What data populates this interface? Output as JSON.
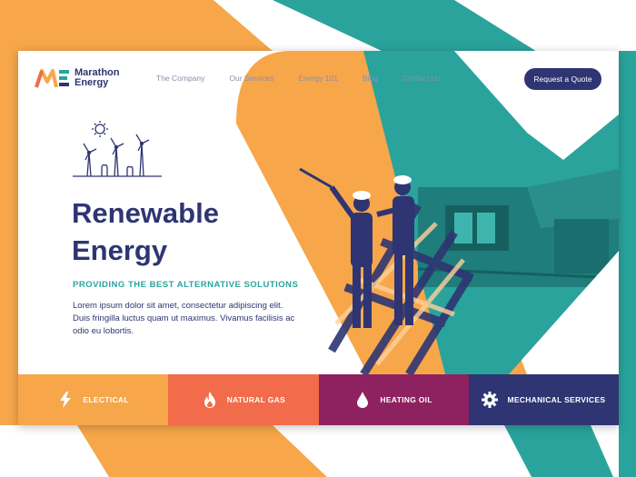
{
  "brand": {
    "name_line1": "Marathon",
    "name_line2": "Energy"
  },
  "nav": {
    "items": [
      {
        "label": "The Company"
      },
      {
        "label": "Our Services"
      },
      {
        "label": "Energy 101"
      },
      {
        "label": "Blog"
      },
      {
        "label": "Contact Us"
      }
    ],
    "cta_label": "Request a Quote"
  },
  "hero": {
    "title_line1": "Renewable",
    "title_line2": "Energy",
    "subtitle": "PROVIDING THE BEST ALTERNATIVE SOLUTIONS",
    "body": "Lorem ipsum dolor sit amet, consectetur adipiscing elit. Duis fringilla luctus quam ut maximus. Vivamus facilisis ac odio eu lobortis.",
    "illustration_icon": "wind-turbines-sun-icon"
  },
  "services": [
    {
      "label": "ELECTICAL",
      "icon": "lightning-bolt-icon",
      "color": "#f7a64a"
    },
    {
      "label": "NATURAL GAS",
      "icon": "flame-icon",
      "color": "#f26b4a"
    },
    {
      "label": "HEATING OIL",
      "icon": "oil-drop-icon",
      "color": "#8e2160"
    },
    {
      "label": "MECHANICAL SERVICES",
      "icon": "gear-icon",
      "color": "#2e3572"
    }
  ],
  "colors": {
    "navy": "#2e3572",
    "teal": "#2aa39c",
    "orange": "#f7a64a",
    "coral": "#f26b4a",
    "plum": "#8e2160"
  }
}
